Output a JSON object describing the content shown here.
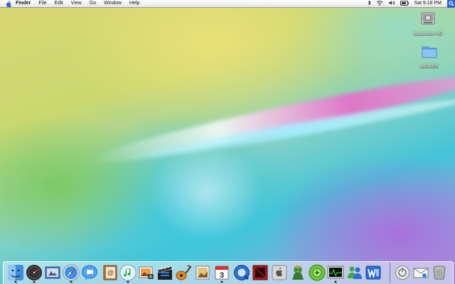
{
  "menubar": {
    "apple_icon": "apple-icon",
    "app_name": "Finder",
    "menus": [
      "File",
      "Edit",
      "View",
      "Go",
      "Window",
      "Help"
    ],
    "status_icons": [
      "bluetooth-icon",
      "wifi-icon",
      "volume-icon",
      "battery-icon"
    ],
    "clock": "Sat 9:18 PM",
    "spotlight_icon": "spotlight-icon"
  },
  "desktop_icons": [
    {
      "label": "Macintosh HD",
      "icon": "hard-drive-icon"
    },
    {
      "label": "MOVIES",
      "icon": "folder-icon"
    }
  ],
  "dock": {
    "apps": [
      {
        "name": "Finder",
        "icon": "finder-icon",
        "running": true
      },
      {
        "name": "Dashboard",
        "icon": "dashboard-icon",
        "running": true
      },
      {
        "name": "Mail",
        "icon": "mail-icon",
        "running": false
      },
      {
        "name": "Safari",
        "icon": "safari-icon",
        "running": true
      },
      {
        "name": "iChat",
        "icon": "ichat-icon",
        "running": false
      },
      {
        "name": "Address Book",
        "icon": "address-book-icon",
        "running": false
      },
      {
        "name": "iTunes",
        "icon": "itunes-icon",
        "running": true
      },
      {
        "name": "iPhoto",
        "icon": "iphoto-icon",
        "running": false
      },
      {
        "name": "iMovie",
        "icon": "imovie-icon",
        "running": false
      },
      {
        "name": "GarageBand",
        "icon": "garageband-icon",
        "running": false
      },
      {
        "name": "Preview",
        "icon": "preview-icon",
        "running": false
      },
      {
        "name": "iCal",
        "icon": "ical-icon",
        "running": true
      },
      {
        "name": "QuickTime Player",
        "icon": "quicktime-icon",
        "running": false
      },
      {
        "name": "Photo Booth",
        "icon": "photo-booth-icon",
        "running": false
      },
      {
        "name": "System Preferences",
        "icon": "system-preferences-icon",
        "running": false
      },
      {
        "name": "Game",
        "icon": "game-icon",
        "running": false
      },
      {
        "name": "Xcode",
        "icon": "green-app-icon",
        "running": false
      },
      {
        "name": "Activity Monitor",
        "icon": "activity-monitor-icon",
        "running": true
      },
      {
        "name": "MSN Messenger",
        "icon": "messenger-icon",
        "running": false
      },
      {
        "name": "Microsoft Word",
        "icon": "word-icon",
        "running": false
      }
    ],
    "right": [
      {
        "name": "Downloads",
        "icon": "downloads-stack-icon"
      },
      {
        "name": "Mail Stack",
        "icon": "envelope-stack-icon"
      },
      {
        "name": "Trash",
        "icon": "trash-icon"
      }
    ],
    "dock_calendar_day": "3"
  }
}
